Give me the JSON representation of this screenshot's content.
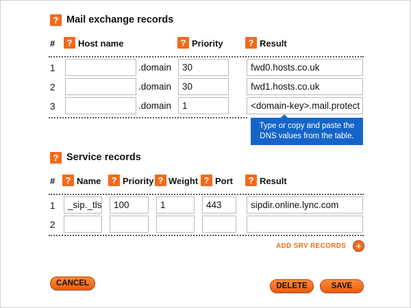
{
  "mx": {
    "title": "Mail exchange records",
    "headers": {
      "num": "#",
      "host": "Host name",
      "priority": "Priority",
      "result": "Result"
    },
    "rows": [
      {
        "num": "1",
        "host": "",
        "suffix": ".domain",
        "priority": "30",
        "result": "fwd0.hosts.co.uk"
      },
      {
        "num": "2",
        "host": "",
        "suffix": ".domain",
        "priority": "30",
        "result": "fwd1.hosts.co.uk"
      },
      {
        "num": "3",
        "host": "",
        "suffix": ".domain",
        "priority": "1",
        "result": "<domain-key>.mail.protect"
      }
    ]
  },
  "tooltip": {
    "text": "Type or copy and paste the DNS values from the table."
  },
  "srv": {
    "title": "Service records",
    "headers": {
      "num": "#",
      "name": "Name",
      "priority": "Priority",
      "weight": "Weight",
      "port": "Port",
      "result": "Result"
    },
    "rows": [
      {
        "num": "1",
        "name": "_sip._tls",
        "priority": "100",
        "weight": "1",
        "port": "443",
        "result": "sipdir.online.lync.com"
      },
      {
        "num": "2",
        "name": "",
        "priority": "",
        "weight": "",
        "port": "",
        "result": ""
      }
    ]
  },
  "icons": {
    "help": "?",
    "add": "+"
  },
  "actions": {
    "add_srv": "ADD SRV RECORDS",
    "cancel": "CANCEL",
    "delete": "DELETE",
    "save": "SAVE"
  },
  "colors": {
    "accent": "#f26a1b",
    "tooltip": "#1565c8"
  }
}
